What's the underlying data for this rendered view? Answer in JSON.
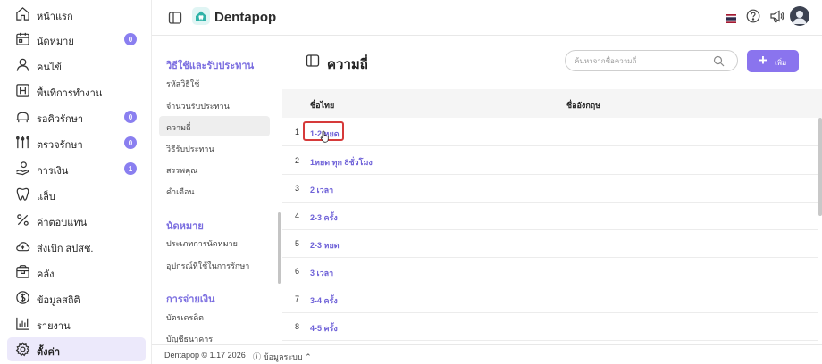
{
  "sidebar": {
    "items": [
      {
        "label": "หน้าแรก",
        "icon": "home-icon"
      },
      {
        "label": "นัดหมาย",
        "icon": "calendar-icon",
        "badge": "0"
      },
      {
        "label": "คนไข้",
        "icon": "user-icon"
      },
      {
        "label": "พื้นที่การทำงาน",
        "icon": "grid-icon"
      },
      {
        "label": "รอคิวรักษา",
        "icon": "waiting-icon",
        "badge": "0"
      },
      {
        "label": "ตรวจรักษา",
        "icon": "tools-icon",
        "badge": "0"
      },
      {
        "label": "การเงิน",
        "icon": "payment-icon",
        "badge": "1"
      },
      {
        "label": "แล็บ",
        "icon": "tooth-icon"
      },
      {
        "label": "ค่าตอบแทน",
        "icon": "percent-icon"
      },
      {
        "label": "ส่งเบิก สปสช.",
        "icon": "cloud-icon"
      },
      {
        "label": "คลัง",
        "icon": "box-icon"
      },
      {
        "label": "ข้อมูลสถิติ",
        "icon": "stats-icon"
      },
      {
        "label": "รายงาน",
        "icon": "report-icon"
      },
      {
        "label": "ตั้งค่า",
        "icon": "gear-icon",
        "active": true
      }
    ]
  },
  "topbar": {
    "brand": "Dentapop",
    "icons": [
      "sidebar-toggle-icon",
      "thai-flag-icon",
      "help-icon",
      "megaphone-icon",
      "avatar"
    ]
  },
  "submenu": {
    "section1": {
      "title": "วิธีใช้และรับประทาน",
      "items": [
        "รหัสวิธีใช้",
        "จำนวนรับประทาน",
        "ความถี่",
        "วิธีรับประทาน",
        "สรรพคุณ",
        "คำเตือน"
      ]
    },
    "section2": {
      "title": "นัดหมาย",
      "items": [
        "ประเภทการนัดหมาย",
        "อุปกรณ์ที่ใช้ในการรักษา"
      ]
    },
    "section3": {
      "title": "การจ่ายเงิน",
      "items": [
        "บัตรเครดิต",
        "บัญชีธนาคาร"
      ]
    }
  },
  "main": {
    "title": "ความถี่",
    "search_placeholder": "ค้นหาจากชื่อความถี่",
    "add_label": "เพิ่ม",
    "columns": [
      "ชื่อไทย",
      "ชื่ออังกฤษ"
    ],
    "rows": [
      {
        "num": "1",
        "name": "1-2 หยด"
      },
      {
        "num": "2",
        "name": "1หยด ทุก 8ชั่วโมง"
      },
      {
        "num": "3",
        "name": "2 เวลา"
      },
      {
        "num": "4",
        "name": "2-3 ครั้ง"
      },
      {
        "num": "5",
        "name": "2-3 หยด"
      },
      {
        "num": "6",
        "name": "3 เวลา"
      },
      {
        "num": "7",
        "name": "3-4 ครั้ง"
      },
      {
        "num": "8",
        "name": "4-5 ครั้ง"
      }
    ]
  },
  "footer": {
    "copyright": "Dentapop © 1.17 2026",
    "system_info": "ⓘ ข้อมูลระบบ ⌃"
  },
  "colors": {
    "accent": "#8a74ee",
    "link": "#6f62d8",
    "active_bg": "#ece9fb",
    "highlight": "#d63a3a"
  }
}
